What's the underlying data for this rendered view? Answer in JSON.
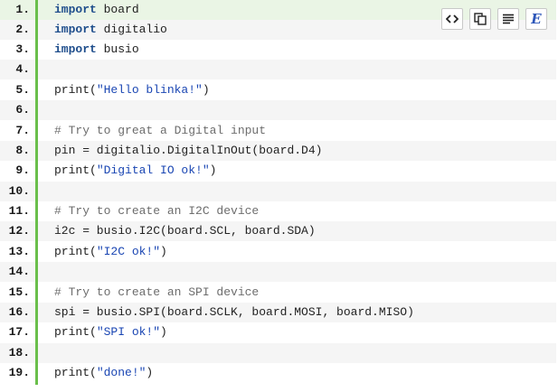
{
  "code_lines": [
    {
      "n": "1.",
      "t": [
        {
          "k": "kw",
          "v": "import"
        },
        {
          "k": "p",
          "v": " board"
        }
      ]
    },
    {
      "n": "2.",
      "t": [
        {
          "k": "kw",
          "v": "import"
        },
        {
          "k": "p",
          "v": " digitalio"
        }
      ]
    },
    {
      "n": "3.",
      "t": [
        {
          "k": "kw",
          "v": "import"
        },
        {
          "k": "p",
          "v": " busio"
        }
      ]
    },
    {
      "n": "4.",
      "t": []
    },
    {
      "n": "5.",
      "t": [
        {
          "k": "p",
          "v": "print("
        },
        {
          "k": "str",
          "v": "\"Hello blinka!\""
        },
        {
          "k": "p",
          "v": ")"
        }
      ]
    },
    {
      "n": "6.",
      "t": []
    },
    {
      "n": "7.",
      "t": [
        {
          "k": "com",
          "v": "# Try to great a Digital input"
        }
      ]
    },
    {
      "n": "8.",
      "t": [
        {
          "k": "p",
          "v": "pin = digitalio.DigitalInOut(board.D4)"
        }
      ]
    },
    {
      "n": "9.",
      "t": [
        {
          "k": "p",
          "v": "print("
        },
        {
          "k": "str",
          "v": "\"Digital IO ok!\""
        },
        {
          "k": "p",
          "v": ")"
        }
      ]
    },
    {
      "n": "10.",
      "t": []
    },
    {
      "n": "11.",
      "t": [
        {
          "k": "com",
          "v": "# Try to create an I2C device"
        }
      ]
    },
    {
      "n": "12.",
      "t": [
        {
          "k": "p",
          "v": "i2c = busio.I2C(board.SCL, board.SDA)"
        }
      ]
    },
    {
      "n": "13.",
      "t": [
        {
          "k": "p",
          "v": "print("
        },
        {
          "k": "str",
          "v": "\"I2C ok!\""
        },
        {
          "k": "p",
          "v": ")"
        }
      ]
    },
    {
      "n": "14.",
      "t": []
    },
    {
      "n": "15.",
      "t": [
        {
          "k": "com",
          "v": "# Try to create an SPI device"
        }
      ]
    },
    {
      "n": "16.",
      "t": [
        {
          "k": "p",
          "v": "spi = busio.SPI(board.SCLK, board.MOSI, board.MISO)"
        }
      ]
    },
    {
      "n": "17.",
      "t": [
        {
          "k": "p",
          "v": "print("
        },
        {
          "k": "str",
          "v": "\"SPI ok!\""
        },
        {
          "k": "p",
          "v": ")"
        }
      ]
    },
    {
      "n": "18.",
      "t": []
    },
    {
      "n": "19.",
      "t": [
        {
          "k": "p",
          "v": "print("
        },
        {
          "k": "str",
          "v": "\"done!\""
        },
        {
          "k": "p",
          "v": ")"
        }
      ]
    }
  ],
  "toolbar": {
    "buttons": [
      {
        "icon": "view-source-icon"
      },
      {
        "icon": "copy-icon"
      },
      {
        "icon": "print-icon"
      },
      {
        "icon": "about-icon",
        "glyph": "E"
      }
    ]
  },
  "colors": {
    "gutter_accent": "#6abf4b",
    "keyword": "#1f4e8c",
    "string": "#1a46b3",
    "comment": "#6d6d6d",
    "highlight_row": "#eaf5e5",
    "alt_row": "#f5f5f5"
  }
}
